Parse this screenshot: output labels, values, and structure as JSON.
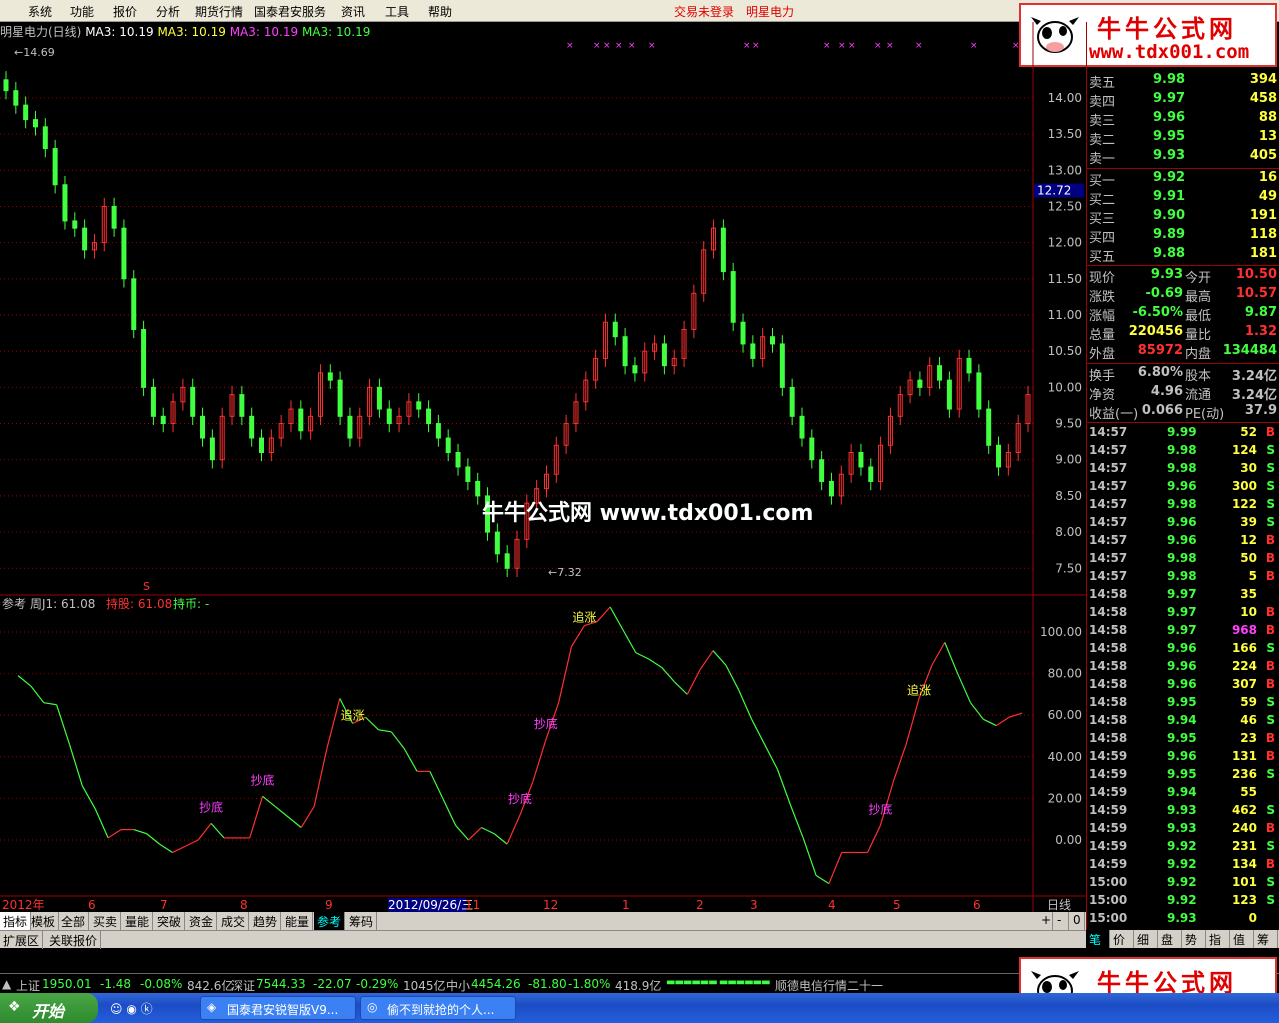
{
  "menu": {
    "items": [
      "系统",
      "功能",
      "报价",
      "分析",
      "期货行情",
      "国泰君安服务",
      "资讯",
      "工具",
      "帮助"
    ],
    "trade_status": "交易未登录",
    "stock_name": "明星电力"
  },
  "chart_title": {
    "name": "明星电力(日线)",
    "ma1": "MA3: 10.19",
    "ma2": "MA3: 10.19",
    "ma3": "MA3: 10.19",
    "ma4": "MA3: 10.19"
  },
  "chart_data": [
    {
      "type": "candlestick",
      "title": "明星电力(日线)",
      "ylim": [
        7.2,
        14.8
      ],
      "yticks": [
        "14.00",
        "13.50",
        "13.00",
        "12.50",
        "12.00",
        "11.50",
        "11.00",
        "10.50",
        "10.00",
        "9.50",
        "9.00",
        "8.50",
        "8.00",
        "7.50"
      ],
      "yvalues": [
        14.0,
        13.5,
        13.0,
        12.5,
        12.0,
        11.5,
        11.0,
        10.5,
        10.0,
        9.5,
        9.0,
        8.5,
        8.0,
        7.5
      ],
      "current_price_label": "12.72",
      "current_price": 12.72,
      "high_label": "14.69",
      "low_label": "7.32",
      "close": [
        14.1,
        13.9,
        13.7,
        13.6,
        13.3,
        12.8,
        12.3,
        12.2,
        11.9,
        12.0,
        12.5,
        12.2,
        11.5,
        10.8,
        10.0,
        9.6,
        9.5,
        9.8,
        10.0,
        9.6,
        9.3,
        9.0,
        9.6,
        9.9,
        9.6,
        9.3,
        9.1,
        9.3,
        9.5,
        9.7,
        9.4,
        9.6,
        10.2,
        10.1,
        9.6,
        9.3,
        9.6,
        10.0,
        9.7,
        9.5,
        9.6,
        9.8,
        9.7,
        9.5,
        9.3,
        9.1,
        8.9,
        8.7,
        8.5,
        8.0,
        7.7,
        7.5,
        7.9,
        8.4,
        8.6,
        8.8,
        9.2,
        9.5,
        9.8,
        10.1,
        10.4,
        10.9,
        10.7,
        10.3,
        10.2,
        10.5,
        10.6,
        10.3,
        10.4,
        10.8,
        11.3,
        11.9,
        12.2,
        11.6,
        10.9,
        10.6,
        10.4,
        10.7,
        10.6,
        10.0,
        9.6,
        9.3,
        9.0,
        8.7,
        8.5,
        8.8,
        9.1,
        8.9,
        8.7,
        9.2,
        9.6,
        9.9,
        10.1,
        10.0,
        10.3,
        10.1,
        9.7,
        10.4,
        10.2,
        9.7,
        9.2,
        8.9,
        9.1,
        9.5,
        9.9
      ]
    },
    {
      "type": "line",
      "title": "参考 周J1: 61.08",
      "ylim": [
        -25,
        112
      ],
      "yticks": [
        "100.00",
        "80.00",
        "60.00",
        "40.00",
        "20.00",
        "0.00"
      ],
      "yvalues": [
        100,
        80,
        60,
        40,
        20,
        0
      ],
      "values": [
        79,
        74,
        66,
        65,
        46,
        26,
        15,
        1,
        5,
        5,
        3,
        -2,
        -6,
        -3,
        0,
        8,
        1,
        1,
        1,
        21,
        16,
        11,
        6,
        16,
        44,
        68,
        56,
        59,
        53,
        52,
        44,
        33,
        33,
        20,
        7,
        0,
        6,
        3,
        -2,
        12,
        28,
        48,
        66,
        93,
        103,
        105,
        112,
        101,
        90,
        87,
        83,
        76,
        70,
        82,
        91,
        84,
        72,
        58,
        46,
        34,
        17,
        1,
        -17,
        -21,
        -6,
        -6,
        -6,
        7,
        28,
        46,
        68,
        84,
        95,
        80,
        66,
        58,
        55,
        59,
        61
      ],
      "annotations": [
        {
          "label": "抄底",
          "i": 15
        },
        {
          "label": "抄底",
          "i": 19
        },
        {
          "label": "追涨",
          "i": 26
        },
        {
          "label": "抄底",
          "i": 39
        },
        {
          "label": "抄底",
          "i": 41
        },
        {
          "label": "追涨",
          "i": 44
        },
        {
          "label": "抄底",
          "i": 67
        },
        {
          "label": "追涨",
          "i": 70
        }
      ]
    }
  ],
  "indicator": {
    "label": "参考",
    "j1": "周J1: 61.08",
    "hold": "持股: 61.08",
    "coin": "持币: -"
  },
  "xaxis": {
    "labels": [
      "2012年",
      "6",
      "7",
      "8",
      "9",
      "2012/09/26/三",
      "11",
      "12",
      "1",
      "2",
      "3",
      "4",
      "5",
      "6"
    ],
    "period": "日线"
  },
  "tabs": [
    "指标",
    "模板",
    "全部",
    "买卖",
    "量能",
    "突破",
    "资金",
    "成交",
    "趋势",
    "能量",
    "参考",
    "筹码"
  ],
  "tabs2": [
    "扩展区",
    "关联报价"
  ],
  "ask": [
    {
      "l": "卖五",
      "p": "9.98",
      "v": "394"
    },
    {
      "l": "卖四",
      "p": "9.97",
      "v": "458"
    },
    {
      "l": "卖三",
      "p": "9.96",
      "v": "88"
    },
    {
      "l": "卖二",
      "p": "9.95",
      "v": "13"
    },
    {
      "l": "卖一",
      "p": "9.93",
      "v": "405"
    }
  ],
  "bid": [
    {
      "l": "买一",
      "p": "9.92",
      "v": "16"
    },
    {
      "l": "买二",
      "p": "9.91",
      "v": "49"
    },
    {
      "l": "买三",
      "p": "9.90",
      "v": "191"
    },
    {
      "l": "买四",
      "p": "9.89",
      "v": "118"
    },
    {
      "l": "买五",
      "p": "9.88",
      "v": "181"
    }
  ],
  "stats": [
    {
      "a": "现价",
      "av": "9.93",
      "b": "今开",
      "bv": "10.50"
    },
    {
      "a": "涨跌",
      "av": "-0.69",
      "b": "最高",
      "bv": "10.57"
    },
    {
      "a": "涨幅",
      "av": "-6.50%",
      "b": "最低",
      "bv": "9.87"
    },
    {
      "a": "总量",
      "av": "220456",
      "b": "量比",
      "bv": "1.32"
    },
    {
      "a": "外盘",
      "av": "85972",
      "b": "内盘",
      "bv": "134484"
    },
    {
      "a": "换手",
      "av": "6.80%",
      "b": "股本",
      "bv": "3.24亿"
    },
    {
      "a": "净资",
      "av": "4.96",
      "b": "流通",
      "bv": "3.24亿"
    },
    {
      "a": "收益(一)",
      "av": "0.066",
      "b": "PE(动)",
      "bv": "37.9"
    }
  ],
  "ticks": [
    [
      "14:57",
      "9.99",
      "52",
      "B"
    ],
    [
      "14:57",
      "9.98",
      "124",
      "S"
    ],
    [
      "14:57",
      "9.98",
      "30",
      "S"
    ],
    [
      "14:57",
      "9.96",
      "300",
      "S"
    ],
    [
      "14:57",
      "9.98",
      "122",
      "S"
    ],
    [
      "14:57",
      "9.96",
      "39",
      "S"
    ],
    [
      "14:57",
      "9.96",
      "12",
      "B"
    ],
    [
      "14:57",
      "9.98",
      "50",
      "B"
    ],
    [
      "14:57",
      "9.98",
      "5",
      "B"
    ],
    [
      "14:58",
      "9.97",
      "35",
      ""
    ],
    [
      "14:58",
      "9.97",
      "10",
      "B"
    ],
    [
      "14:58",
      "9.97",
      "968",
      "B"
    ],
    [
      "14:58",
      "9.96",
      "166",
      "S"
    ],
    [
      "14:58",
      "9.96",
      "224",
      "B"
    ],
    [
      "14:58",
      "9.96",
      "307",
      "B"
    ],
    [
      "14:58",
      "9.95",
      "59",
      "S"
    ],
    [
      "14:58",
      "9.94",
      "46",
      "S"
    ],
    [
      "14:58",
      "9.95",
      "23",
      "B"
    ],
    [
      "14:59",
      "9.96",
      "131",
      "B"
    ],
    [
      "14:59",
      "9.95",
      "236",
      "S"
    ],
    [
      "14:59",
      "9.94",
      "55",
      ""
    ],
    [
      "14:59",
      "9.93",
      "462",
      "S"
    ],
    [
      "14:59",
      "9.93",
      "240",
      "B"
    ],
    [
      "14:59",
      "9.92",
      "231",
      "S"
    ],
    [
      "14:59",
      "9.92",
      "134",
      "B"
    ],
    [
      "15:00",
      "9.92",
      "101",
      "S"
    ],
    [
      "15:00",
      "9.92",
      "123",
      "S"
    ],
    [
      "15:00",
      "9.93",
      "0",
      ""
    ]
  ],
  "right_tabs": [
    "笔",
    "价",
    "细",
    "盘",
    "势",
    "指",
    "值",
    "筹"
  ],
  "status": {
    "sh_name": "上证",
    "sh_val": "1950.01",
    "sh_chg": "-1.48",
    "sh_pct": "-0.08%",
    "sh_amt": "842.6亿",
    "sz_name": "深证",
    "sz_val": "7544.33",
    "sz_chg": "-22.07",
    "sz_pct": "-0.29%",
    "sz_amt": "1045亿",
    "zx_name": "中小",
    "zx_val": "4454.26",
    "zx_chg": "-81.80",
    "zx_pct": "-1.80%",
    "zx_amt": "418.9亿",
    "news": "顺德电信行情二十一"
  },
  "taskbar": {
    "start": "开始",
    "btn1": "国泰君安锐智版V9...",
    "btn2": "偷不到就抢的个人..."
  },
  "logo": {
    "title": "牛牛公式网",
    "url": "www.tdx001.com"
  },
  "watermark": "牛牛公式网 www.tdx001.com",
  "colors": {
    "up": "#ff3030",
    "down": "#40ff40",
    "grid": "#a00000",
    "price": "#ffff40",
    "cyan": "#00ffff"
  }
}
